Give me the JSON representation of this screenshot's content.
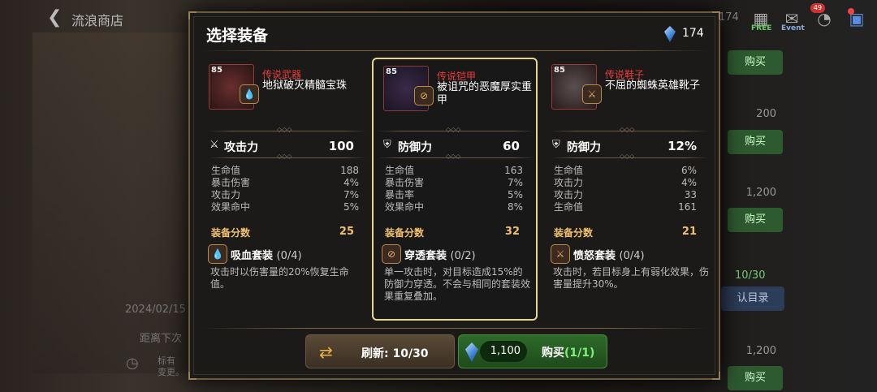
{
  "background": {
    "shop_title": "流浪商店",
    "top_currency": "174",
    "free_label": "FREE",
    "event_label": "Event",
    "notif_count": "49",
    "prices": [
      "200",
      "1,200",
      "1,200"
    ],
    "buy_label": "购买",
    "date": "2024/02/15",
    "timer": "距离下次",
    "desc_partial": "标有",
    "desc_partial2": "变更。",
    "progress": "10/30",
    "catalog_label": "认目录"
  },
  "modal": {
    "title": "选择装备",
    "gem_count": "174",
    "cards": [
      {
        "category": "传说武器",
        "name": "地狱破灭精髓宝珠",
        "level": "85",
        "main_stat": "攻击力",
        "main_value": "100",
        "main_icon": "sword-icon",
        "subs": [
          [
            "生命值",
            "188"
          ],
          [
            "暴击伤害",
            "4%"
          ],
          [
            "攻击力",
            "7%"
          ],
          [
            "效果命中",
            "5%"
          ]
        ],
        "score_label": "装备分数",
        "score": "25",
        "set_name": "吸血套装",
        "set_count": "(0/4)",
        "set_desc": "攻击时以伤害量的20%恢复生命值。"
      },
      {
        "category": "传说铠甲",
        "name": "被诅咒的恶魔厚实重甲",
        "level": "85",
        "main_stat": "防御力",
        "main_value": "60",
        "main_icon": "shield-icon",
        "subs": [
          [
            "生命值",
            "163"
          ],
          [
            "暴击伤害",
            "7%"
          ],
          [
            "暴击率",
            "5%"
          ],
          [
            "效果命中",
            "8%"
          ]
        ],
        "score_label": "装备分数",
        "score": "32",
        "set_name": "穿透套装",
        "set_count": "(0/2)",
        "set_desc": "单一攻击时，对目标造成15%的防御力穿透。不会与相同的套装效果重复叠加。"
      },
      {
        "category": "传说鞋子",
        "name": "不屈的蜘蛛英雄靴子",
        "level": "85",
        "main_stat": "防御力",
        "main_value": "12%",
        "main_icon": "shield-icon",
        "subs": [
          [
            "生命值",
            "6%"
          ],
          [
            "攻击力",
            "4%"
          ],
          [
            "攻击力",
            "33"
          ],
          [
            "生命值",
            "161"
          ]
        ],
        "score_label": "装备分数",
        "score": "21",
        "set_name": "愤怒套装",
        "set_count": "(0/4)",
        "set_desc": "攻击时，若目标身上有弱化效果，伤害量提升30%。"
      }
    ],
    "refresh_label": "刷新: 10/30",
    "buy_price": "1,100",
    "buy_label": "购买",
    "buy_count": "(1/1)"
  }
}
